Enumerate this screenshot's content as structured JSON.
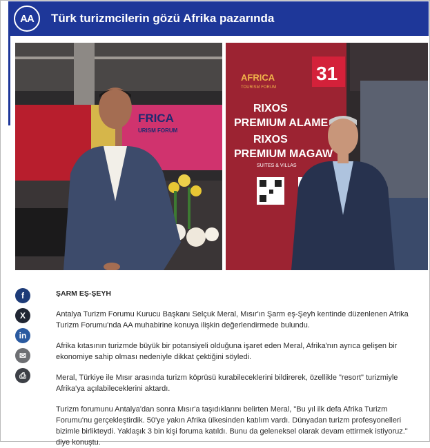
{
  "header": {
    "logo_text": "AA",
    "title": "Türk turizmcilerin gözü Afrika pazarında"
  },
  "photo_left": {
    "banner_text": "FRICA",
    "banner_sub": "URISM FORUM"
  },
  "photo_right": {
    "sign_logo": "AFRICA",
    "sign_logo_sub": "TOURISM FORUM",
    "booth_number": "31",
    "line1": "RIXOS",
    "line2": "PREMIUM ALAME",
    "line3": "RIXOS",
    "line4": "PREMIUM MAGAW",
    "line5": "SUITES & VILLAS"
  },
  "share": {
    "facebook": "f",
    "x": "X",
    "linkedin": "in",
    "mail": "✉",
    "print": "⎙"
  },
  "article": {
    "dateline": "ŞARM EŞ-ŞEYH",
    "paragraphs": [
      "Antalya Turizm Forumu Kurucu Başkanı Selçuk Meral, Mısır'ın Şarm eş-Şeyh kentinde düzenlenen Afrika Turizm Forumu'nda AA muhabirine konuya ilişkin değerlendirmede bulundu.",
      "Afrika kıtasının turizmde büyük bir potansiyeli olduğuna işaret eden Meral, Afrika'nın ayrıca gelişen bir ekonomiye sahip olması nedeniyle dikkat çektiğini söyledi.",
      "Meral, Türkiye ile Mısır arasında turizm köprüsü kurabileceklerini bildirerek, özellikle \"resort\" turizmiyle Afrika'ya açılabileceklerini aktardı.",
      "Turizm forumunu Antalya'dan sonra Mısır'a taşıdıklarını belirten Meral, \"Bu yıl ilk defa Afrika Turizm Forumu'nu gerçekleştirdik. 50'ye yakın Afrika ülkesinden katılım vardı. Dünyadan turizm profesyonelleri bizimle birlikteydi. Yaklaşık 3 bin kişi foruma katıldı. Bunu da geleneksel olarak devam ettirmek istiyoruz.\" diye konuştu."
    ]
  }
}
